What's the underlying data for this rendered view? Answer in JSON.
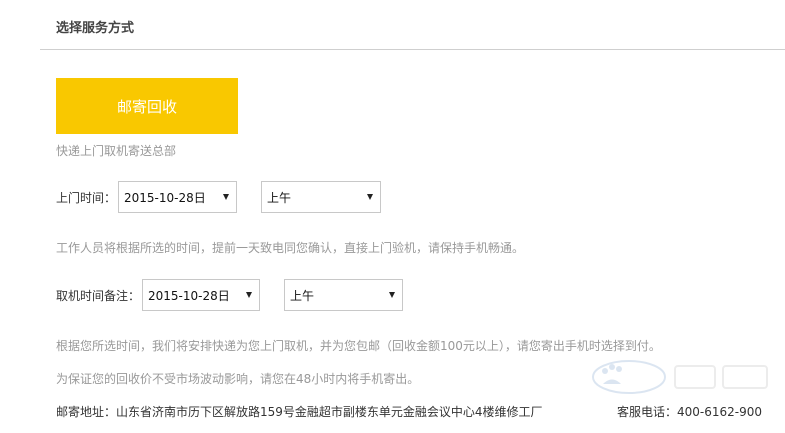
{
  "section": {
    "title": "选择服务方式"
  },
  "method": {
    "button_label": "邮寄回收",
    "description": "快递上门取机寄送总部"
  },
  "pickup": {
    "label": "上门时间：",
    "date": "2015-10-28日",
    "period": "上午"
  },
  "pickup_note": "工作人员将根据所选的时间，提前一天致电同您确认，直接上门验机，请保持手机畅通。",
  "collection": {
    "label": "取机时间备注：",
    "date": "2015-10-28日",
    "period": "上午"
  },
  "notes": {
    "shipping": "根据您所选时间，我们将安排快递为您上门取机，并为您包邮（回收金额100元以上），请您寄出手机时选择到付。",
    "price_guarantee": "为保证您的回收价不受市场波动影响，请您在48小时内将手机寄出。"
  },
  "footer": {
    "address": "邮寄地址：山东省济南市历下区解放路159号金融超市副楼东单元金融会议中心4楼维修工厂",
    "hotline": "客服电话：400-6162-900"
  },
  "colors": {
    "accent": "#f9c800",
    "muted_text": "#999999",
    "divider": "#cfcfcf"
  },
  "icons": {
    "select_caret": "caret-down-icon",
    "watermark": "baidu-jingyan-watermark"
  }
}
